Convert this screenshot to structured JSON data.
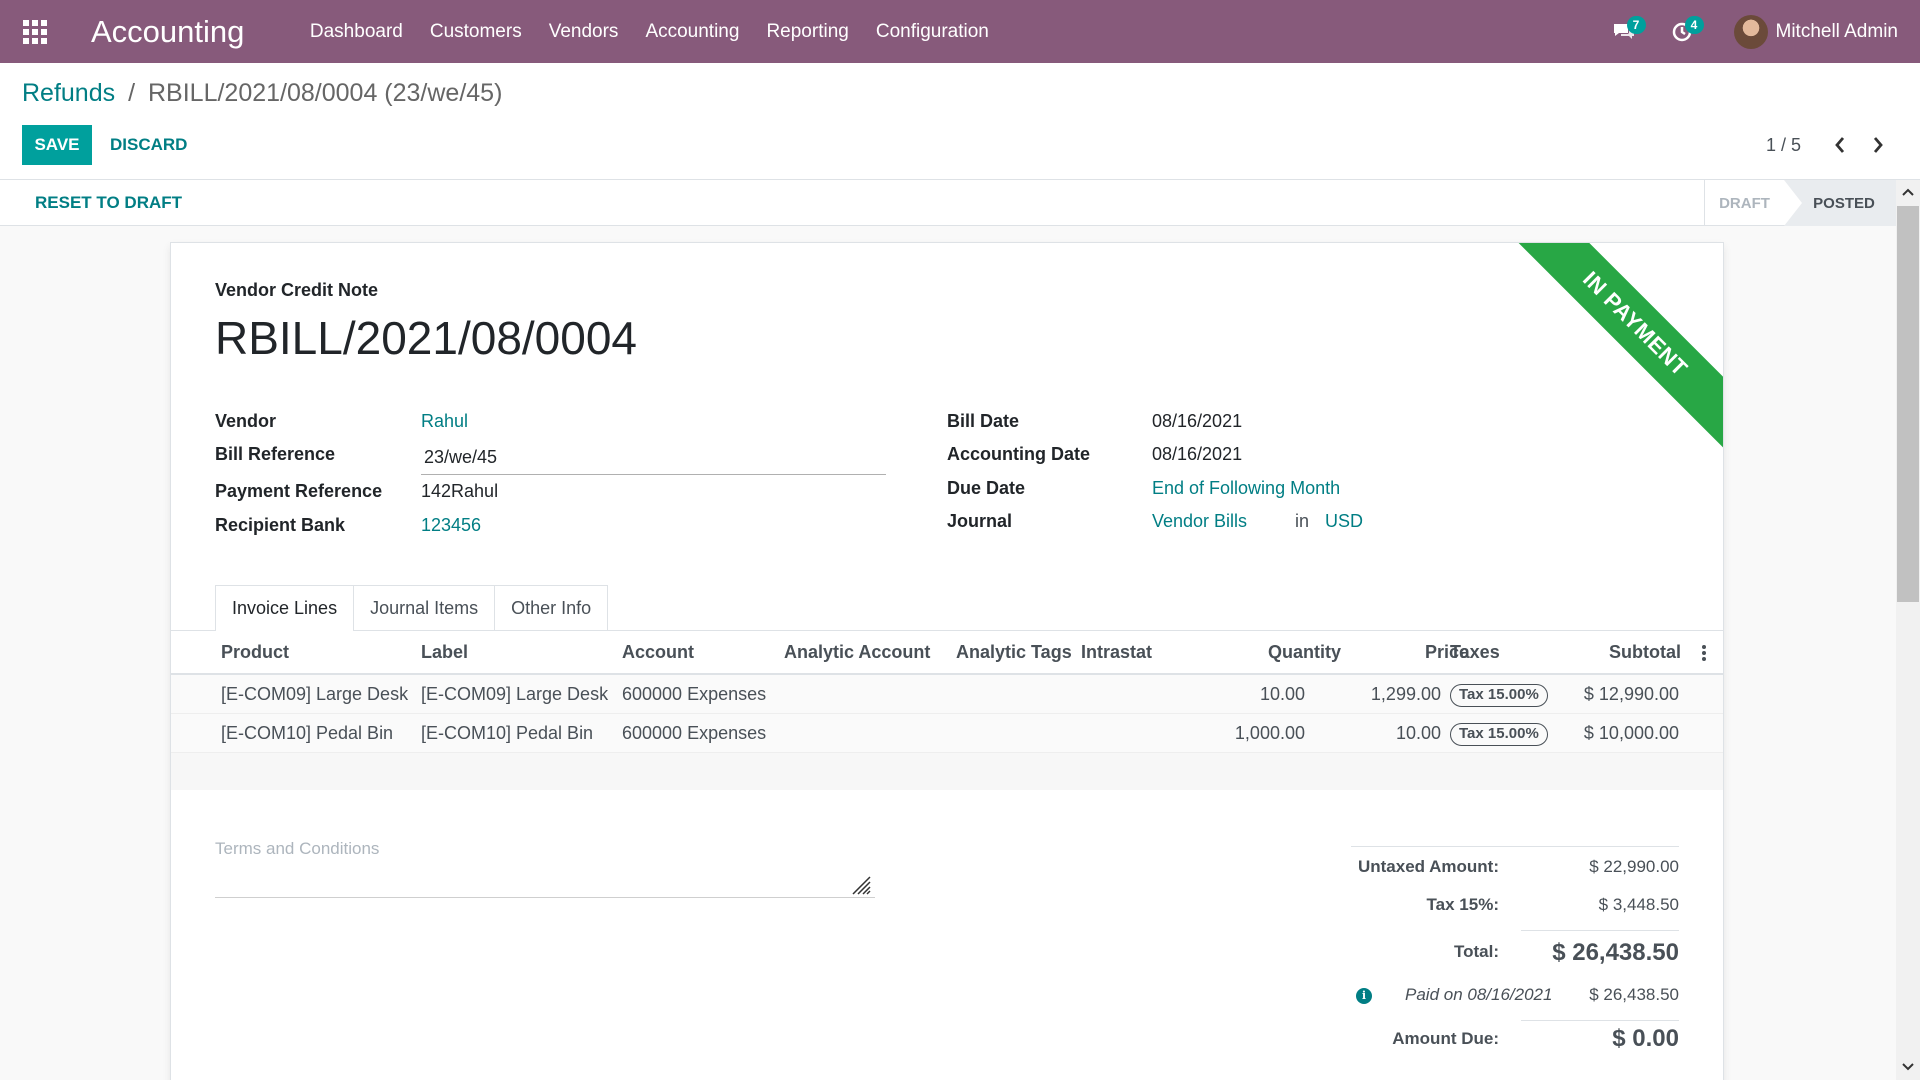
{
  "navbar": {
    "app_title": "Accounting",
    "menu": [
      "Dashboard",
      "Customers",
      "Vendors",
      "Accounting",
      "Reporting",
      "Configuration"
    ],
    "messages_count": "7",
    "activities_count": "4",
    "user_name": "Mitchell Admin"
  },
  "breadcrumb": {
    "parent": "Refunds",
    "separator": "/",
    "current": "RBILL/2021/08/0004 (23/we/45)"
  },
  "buttons": {
    "save": "SAVE",
    "discard": "DISCARD",
    "reset": "RESET TO DRAFT"
  },
  "pager": {
    "text": "1 / 5"
  },
  "status": {
    "stages": [
      "DRAFT",
      "POSTED"
    ],
    "current": "POSTED"
  },
  "document": {
    "type_label": "Vendor Credit Note",
    "name": "RBILL/2021/08/0004",
    "ribbon": "IN PAYMENT"
  },
  "fields_left": {
    "vendor_label": "Vendor",
    "vendor": "Rahul",
    "bill_ref_label": "Bill Reference",
    "bill_ref": "23/we/45",
    "payment_ref_label": "Payment Reference",
    "payment_ref": "142Rahul",
    "bank_label": "Recipient Bank",
    "bank": "123456"
  },
  "fields_right": {
    "bill_date_label": "Bill Date",
    "bill_date": "08/16/2021",
    "acc_date_label": "Accounting Date",
    "acc_date": "08/16/2021",
    "due_date_label": "Due Date",
    "due_date": "End of Following Month",
    "journal_label": "Journal",
    "journal": "Vendor Bills",
    "in_word": "in",
    "currency": "USD"
  },
  "tabs": [
    "Invoice Lines",
    "Journal Items",
    "Other Info"
  ],
  "table": {
    "headers": [
      "Product",
      "Label",
      "Account",
      "Analytic Account",
      "Analytic Tags",
      "Intrastat",
      "Quantity",
      "Price",
      "Taxes",
      "Subtotal"
    ],
    "rows": [
      {
        "product": "[E-COM09] Large Desk",
        "label": "[E-COM09] Large Desk",
        "account": "600000 Expenses",
        "quantity": "10.00",
        "price": "1,299.00",
        "tax": "Tax 15.00%",
        "subtotal": "$ 12,990.00"
      },
      {
        "product": "[E-COM10] Pedal Bin",
        "label": "[E-COM10] Pedal Bin",
        "account": "600000 Expenses",
        "quantity": "1,000.00",
        "price": "10.00",
        "tax": "Tax 15.00%",
        "subtotal": "$ 10,000.00"
      }
    ]
  },
  "terms": {
    "placeholder": "Terms and Conditions"
  },
  "totals": {
    "untaxed_label": "Untaxed Amount:",
    "untaxed": "$ 22,990.00",
    "tax_label": "Tax 15%:",
    "tax": "$ 3,448.50",
    "total_label": "Total:",
    "total": "$ 26,438.50",
    "paid_label": "Paid on 08/16/2021",
    "paid": "$ 26,438.50",
    "due_label": "Amount Due:",
    "due": "$ 0.00"
  },
  "colors": {
    "brand": "#875a7b",
    "accent": "#00a09d",
    "link": "#017e84",
    "ribbon": "#28a745"
  }
}
